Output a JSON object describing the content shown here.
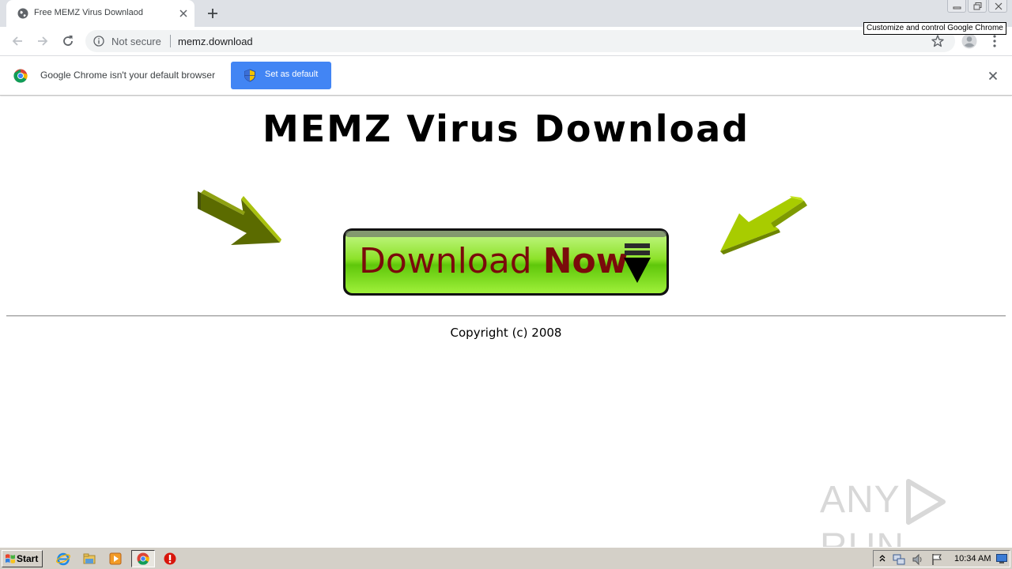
{
  "browser": {
    "tab": {
      "title": "Free MEMZ Virus Downlaod"
    },
    "address": {
      "security_label": "Not secure",
      "url": "memz.download"
    },
    "tooltip": "Customize and control Google Chrome"
  },
  "infobar": {
    "message": "Google Chrome isn't your default browser",
    "button_label": "Set as default"
  },
  "page": {
    "heading": "MEMZ Virus Download",
    "download_button": {
      "label_regular": "Download",
      "label_bold": "Now"
    },
    "copyright": "Copyright (c) 2008",
    "watermark": {
      "left": "ANY",
      "right": "RUN"
    }
  },
  "taskbar": {
    "start_label": "Start",
    "pinned": [
      "internet-explorer-icon",
      "file-explorer-icon",
      "media-player-icon",
      "chrome-icon",
      "stop-icon"
    ],
    "clock": "10:34 AM"
  },
  "colors": {
    "accent_blue": "#4285f4",
    "button_green": "#7fd60f",
    "button_text": "#7a0b0b",
    "arrow_green": "#a6c80a"
  }
}
